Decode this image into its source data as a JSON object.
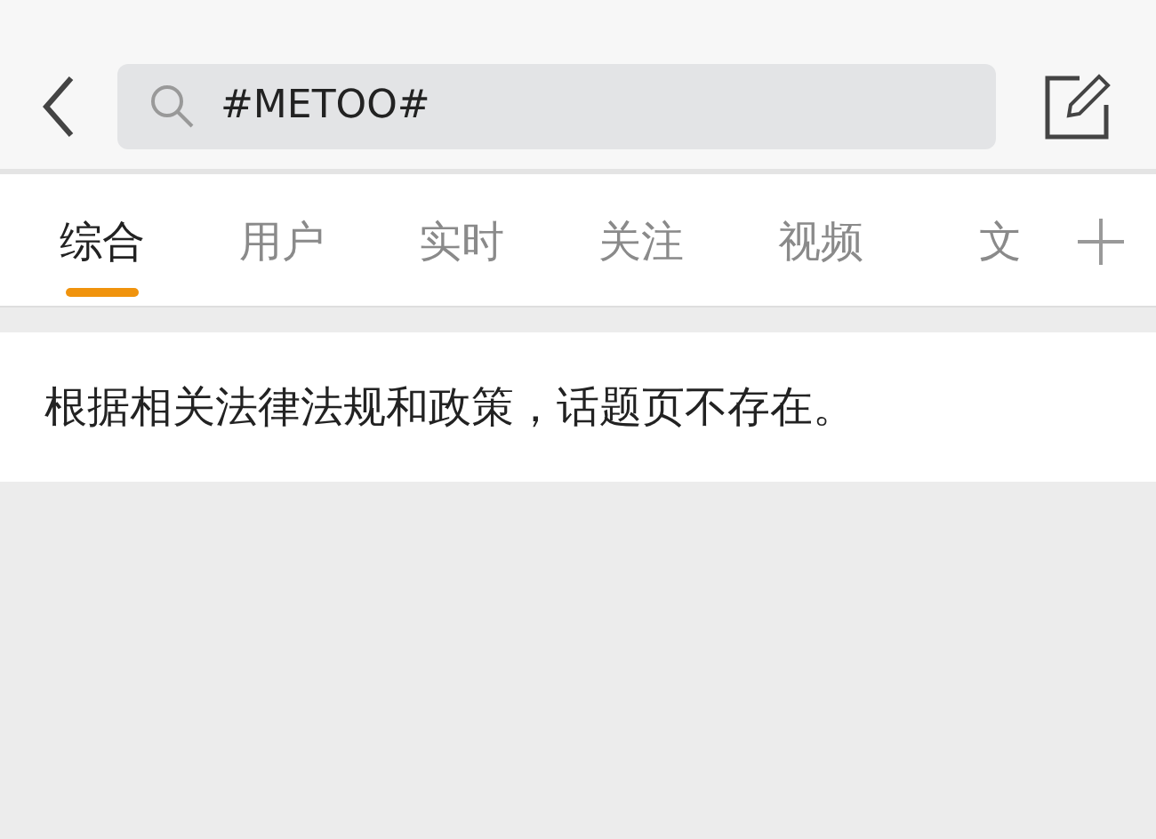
{
  "search": {
    "value": "#METOO#"
  },
  "tabs": [
    {
      "label": "综合",
      "selected": true
    },
    {
      "label": "用户",
      "selected": false
    },
    {
      "label": "实时",
      "selected": false
    },
    {
      "label": "关注",
      "selected": false
    },
    {
      "label": "视频",
      "selected": false
    },
    {
      "label": "文",
      "selected": false
    }
  ],
  "message": "根据相关法律法规和政策，话题页不存在。"
}
